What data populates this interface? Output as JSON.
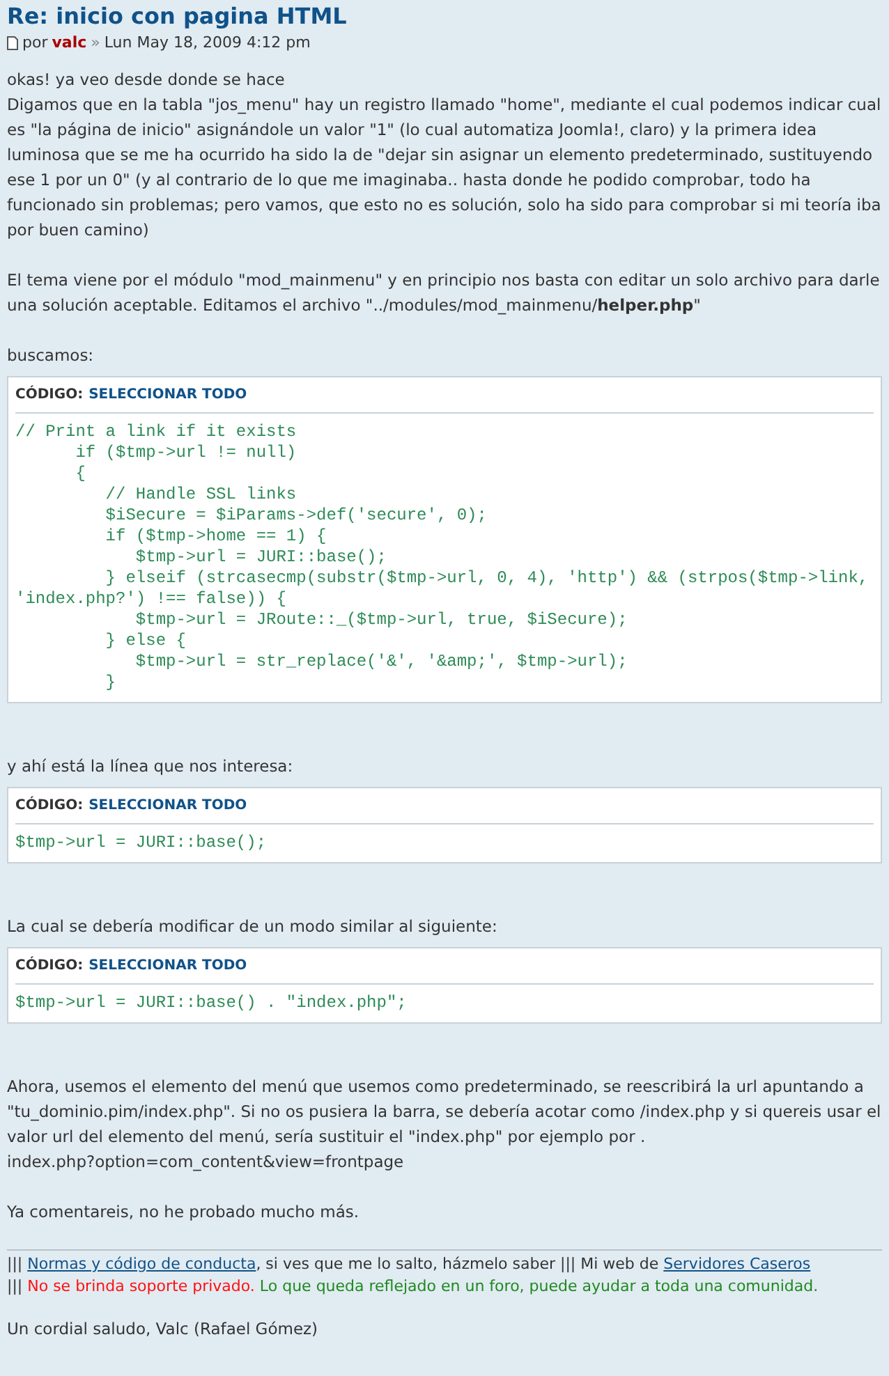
{
  "post": {
    "title": "Re: inicio con pagina HTML",
    "author_prefix": "por",
    "author": "valc",
    "separator": "»",
    "date": "Lun May 18, 2009 4:12 pm"
  },
  "body": [
    {
      "kind": "paragraph",
      "text": "okas! ya veo desde donde se hace\nDigamos que en la tabla \"jos_menu\" hay un registro llamado \"home\", mediante el cual podemos indicar cual es \"la página de inicio\" asignándole un valor \"1\" (lo cual automatiza Joomla!, claro) y la primera idea luminosa que se me ha ocurrido ha sido la de \"dejar sin asignar un elemento predeterminado, sustituyendo ese 1 por un 0\" (y al contrario de lo que me imaginaba.. hasta donde he podido comprobar, todo ha funcionado sin problemas; pero vamos, que esto no es solución, solo ha sido para comprobar si mi teoría iba por buen camino)"
    },
    {
      "kind": "paragraph",
      "text": "El tema viene por el módulo \"mod_mainmenu\" y en principio nos basta con editar un solo archivo para darle una solución aceptable. Editamos el archivo \"../modules/mod_mainmenu/**helper.php**\""
    },
    {
      "kind": "paragraph",
      "text": "buscamos:"
    },
    {
      "kind": "code",
      "label": "CÓDIGO:",
      "action": "SELECCIONAR TODO",
      "lines": [
        "// Print a link if it exists",
        "      if ($tmp->url != null)",
        "      {",
        "         // Handle SSL links",
        "         $iSecure = $iParams->def('secure', 0);",
        "         if ($tmp->home == 1) {",
        "            $tmp->url = JURI::base();",
        "         } elseif (strcasecmp(substr($tmp->url, 0, 4), 'http') && (strpos($tmp->link,",
        "'index.php?') !== false)) {",
        "            $tmp->url = JRoute::_($tmp->url, true, $iSecure);",
        "         } else {",
        "            $tmp->url = str_replace('&', '&amp;', $tmp->url);",
        "         }"
      ]
    },
    {
      "kind": "paragraph",
      "text": "y ahí está la línea que nos interesa:"
    },
    {
      "kind": "code",
      "label": "CÓDIGO:",
      "action": "SELECCIONAR TODO",
      "lines": [
        "$tmp->url = JURI::base();"
      ]
    },
    {
      "kind": "paragraph",
      "text": "La cual se debería modificar de un modo similar al siguiente:"
    },
    {
      "kind": "code",
      "label": "CÓDIGO:",
      "action": "SELECCIONAR TODO",
      "lines": [
        "$tmp->url = JURI::base() . \"index.php\";"
      ]
    },
    {
      "kind": "paragraph",
      "text": "Ahora, usemos el elemento del menú que usemos como predeterminado, se reescribirá la url apuntando a \"tu_dominio.pim/index.php\". Si no os pusiera la barra, se debería acotar como /index.php y si quereis usar el valor url del elemento del menú, sería sustituir el \"index.php\" por ejemplo por .\nindex.php?option=com_content&view=frontpage"
    },
    {
      "kind": "paragraph",
      "text": "Ya comentareis, no he probado mucho más."
    }
  ],
  "signature": {
    "lines": [
      [
        {
          "kind": "text",
          "text": "||| "
        },
        {
          "kind": "link",
          "text": "Normas y código de conducta"
        },
        {
          "kind": "text",
          "text": ", si ves que me lo salto, házmelo saber ||| Mi web de "
        },
        {
          "kind": "link",
          "text": "Servidores Caseros"
        }
      ],
      [
        {
          "kind": "text",
          "text": "||| "
        },
        {
          "kind": "warning",
          "text": "No se brinda soporte privado."
        },
        {
          "kind": "note",
          "text": " Lo que queda reflejado en un foro, puede ayudar a toda una comunidad."
        }
      ]
    ],
    "closing": "Un cordial saludo, Valc (Rafael Gómez)"
  }
}
